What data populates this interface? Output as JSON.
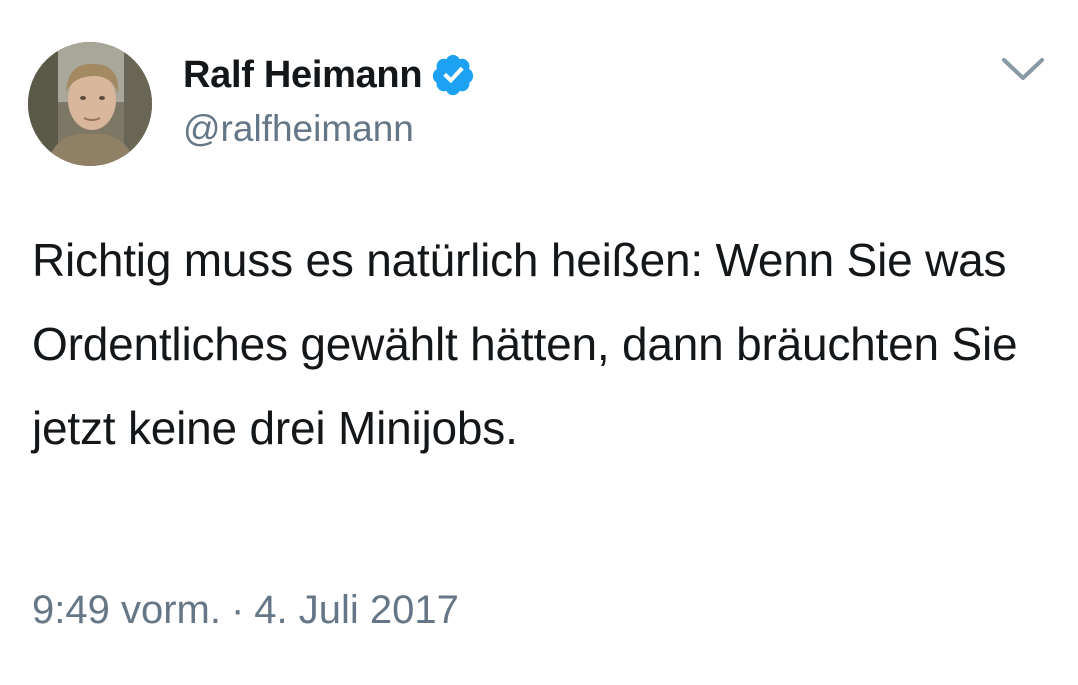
{
  "author": {
    "display_name": "Ralf Heimann",
    "handle": "@ralfheimann",
    "verified": true
  },
  "tweet": {
    "text": "Richtig muss es natürlich heißen: Wenn Sie was Ordentliches gewählt hätten, dann bräuchten Sie jetzt keine drei Minijobs.",
    "time": "9:49 vorm.",
    "separator": "·",
    "date": "4. Juli 2017"
  },
  "icons": {
    "verified": "verified-badge-icon",
    "menu": "chevron-down-icon"
  },
  "colors": {
    "verified_blue": "#1da1f2",
    "secondary_text": "#657786",
    "primary_text": "#14171a"
  }
}
